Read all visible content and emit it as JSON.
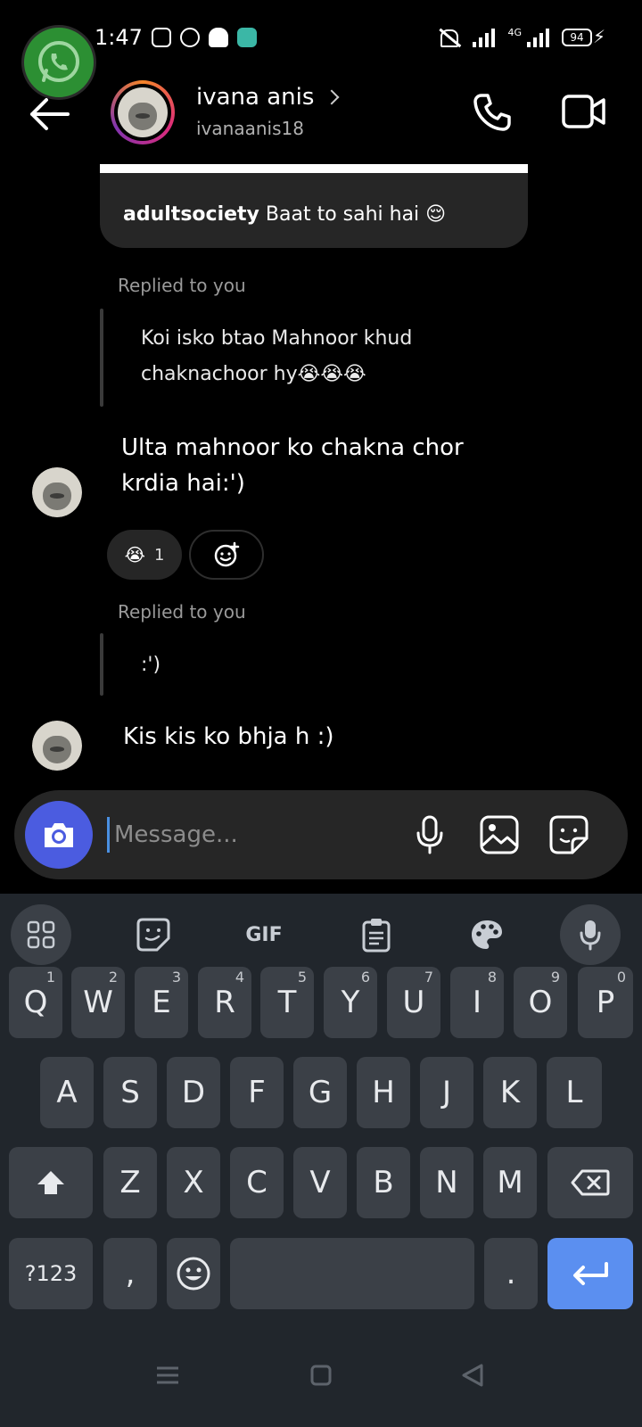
{
  "status_bar": {
    "time": "1:47",
    "network": "4G",
    "battery": "94"
  },
  "header": {
    "name": "ivana anis",
    "username": "ivanaanis18"
  },
  "messages": {
    "shared_post": {
      "account": "adultsociety",
      "caption": "Baat to sahi hai 😌"
    },
    "reply_1": {
      "label": "Replied to you",
      "quote_line_1": "Koi isko btao Mahnoor khud",
      "quote_line_2": "chaknachoor hy😭😭😭",
      "text_line_1": "Ulta mahnoor ko chakna chor",
      "text_line_2": "krdia hai:')",
      "reaction_emoji": "😭",
      "reaction_count": "1"
    },
    "reply_2": {
      "label": "Replied to you",
      "quote": ":')",
      "text": "Kis kis ko bhja h :)"
    }
  },
  "composer": {
    "placeholder": "Message..."
  },
  "keyboard": {
    "toolbar": {
      "gif_label": "GIF"
    },
    "row1": [
      {
        "key": "Q",
        "hint": "1"
      },
      {
        "key": "W",
        "hint": "2"
      },
      {
        "key": "E",
        "hint": "3"
      },
      {
        "key": "R",
        "hint": "4"
      },
      {
        "key": "T",
        "hint": "5"
      },
      {
        "key": "Y",
        "hint": "6"
      },
      {
        "key": "U",
        "hint": "7"
      },
      {
        "key": "I",
        "hint": "8"
      },
      {
        "key": "O",
        "hint": "9"
      },
      {
        "key": "P",
        "hint": "0"
      }
    ],
    "row2": [
      "A",
      "S",
      "D",
      "F",
      "G",
      "H",
      "J",
      "K",
      "L"
    ],
    "row3": [
      "Z",
      "X",
      "C",
      "V",
      "B",
      "N",
      "M"
    ],
    "symbols_label": "?123",
    "comma": ",",
    "period": "."
  },
  "colors": {
    "accent_blue": "#4b5ce0",
    "enter_blue": "#5b8ff0",
    "whatsapp_green": "#2c8f33"
  }
}
